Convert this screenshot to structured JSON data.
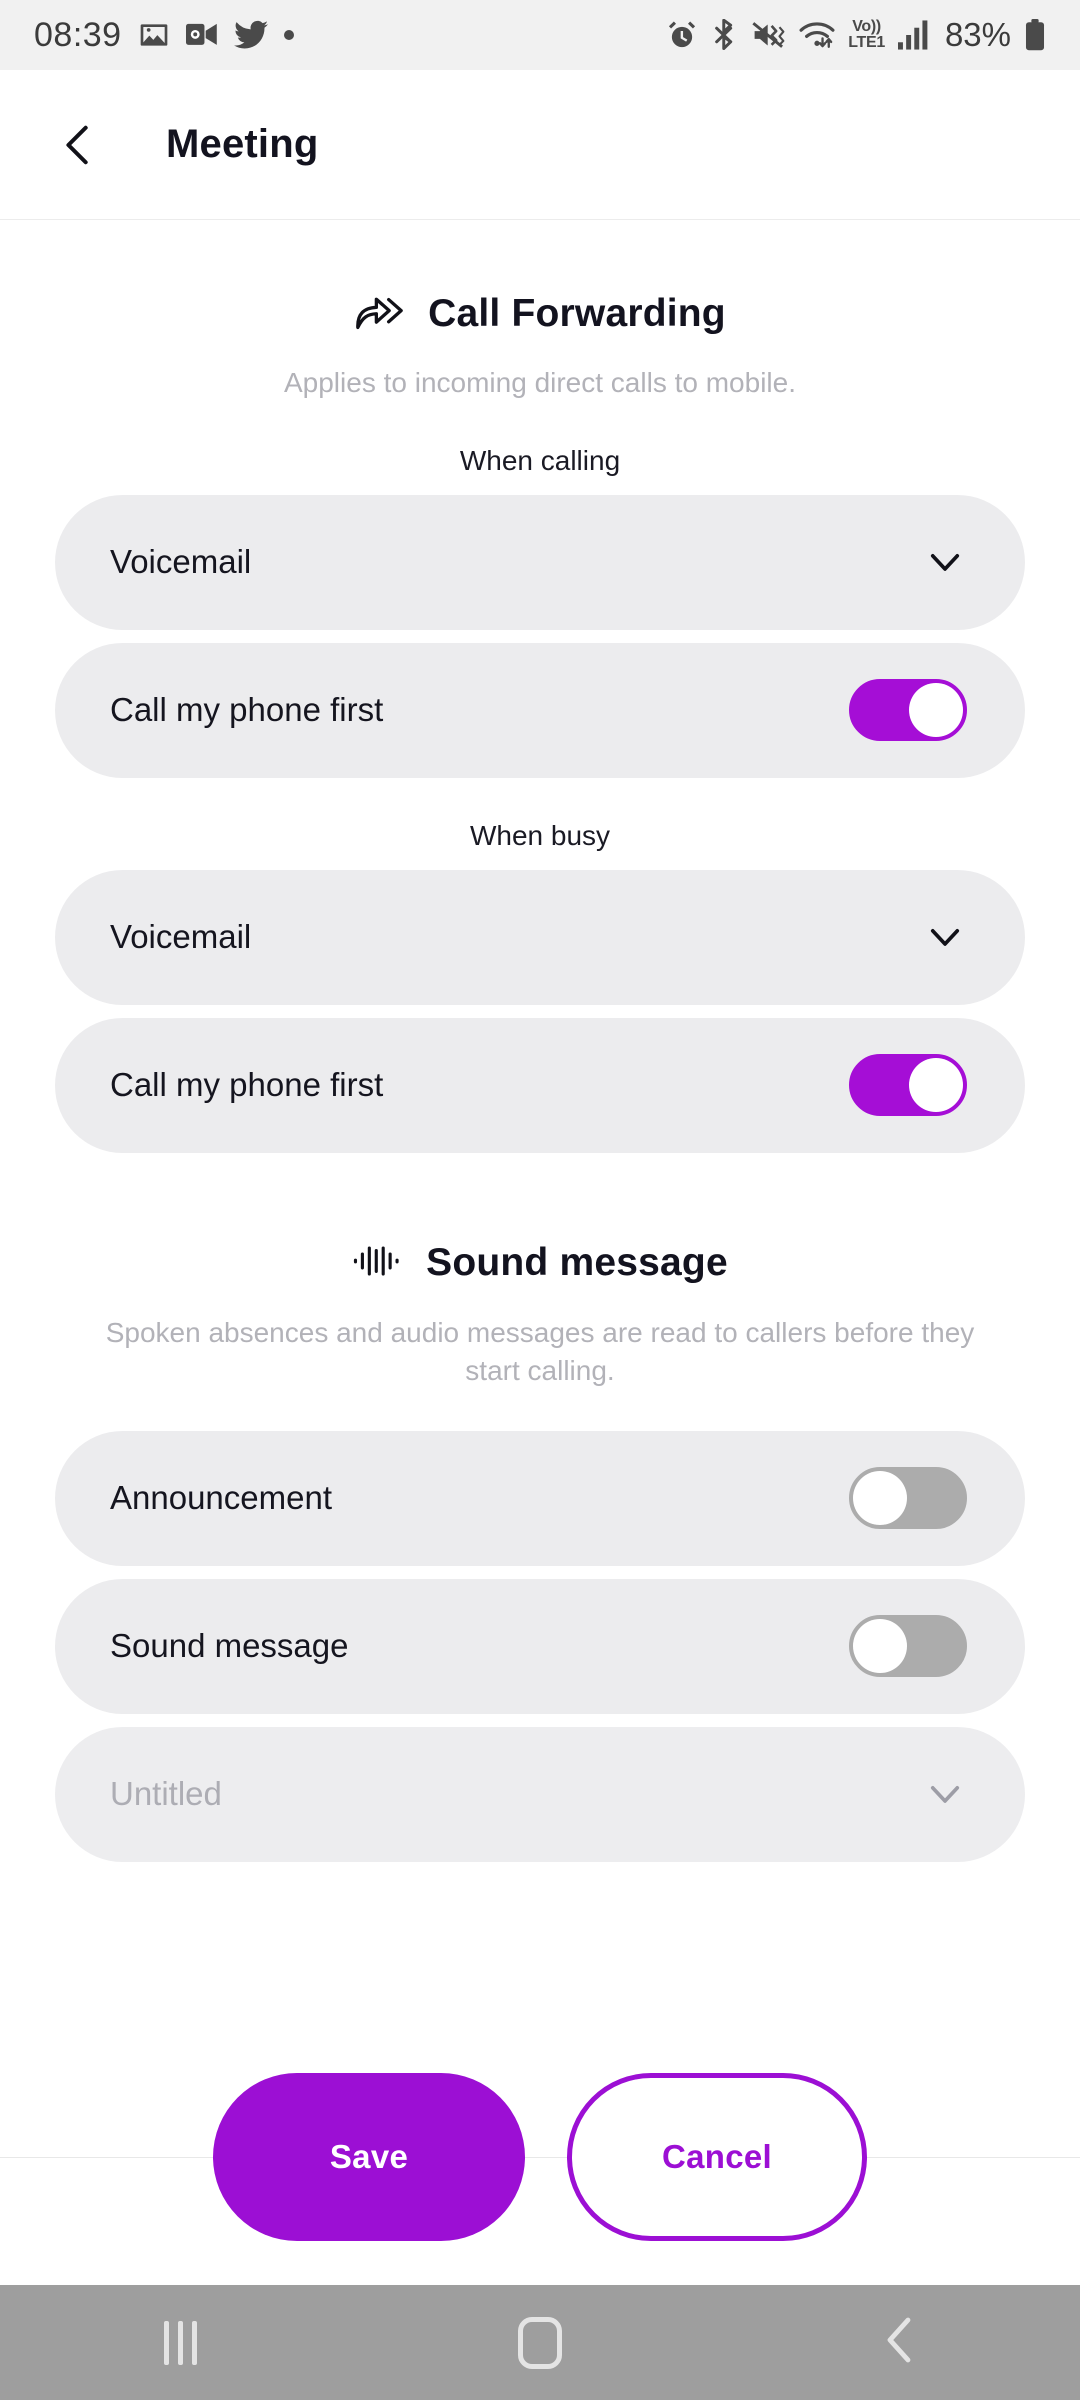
{
  "status_bar": {
    "time": "08:39",
    "left_icons": [
      "photos-icon",
      "outlook-calendar-icon",
      "twitter-icon",
      "more-notifications-dot"
    ],
    "right_icons": [
      "alarm-icon",
      "bluetooth-icon",
      "mute-vibrate-icon",
      "wifi-icon",
      "volte-icon",
      "signal-bars-icon",
      "battery-icon"
    ],
    "network_label_top": "Vo))",
    "network_label_bottom": "LTE1",
    "battery_percent": "83%"
  },
  "app_bar": {
    "back_label": "back-chevron",
    "title": "Meeting"
  },
  "call_forwarding": {
    "icon": "forward-arrow-icon",
    "title": "Call Forwarding",
    "description": "Applies to incoming direct calls to mobile.",
    "groups": [
      {
        "label": "When calling",
        "select": {
          "value": "Voicemail",
          "chevron": "chevron-down-icon"
        },
        "toggle": {
          "label": "Call my phone first",
          "state": "on"
        }
      },
      {
        "label": "When busy",
        "select": {
          "value": "Voicemail",
          "chevron": "chevron-down-icon"
        },
        "toggle": {
          "label": "Call my phone first",
          "state": "on"
        }
      }
    ]
  },
  "sound_message": {
    "icon": "waveform-icon",
    "title": "Sound message",
    "description": "Spoken absences and audio messages are read to callers before they start calling.",
    "rows": [
      {
        "label": "Announcement",
        "state": "off"
      },
      {
        "label": "Sound message",
        "state": "off"
      }
    ],
    "select": {
      "value": "Untitled",
      "chevron": "chevron-down-icon",
      "disabled": true
    }
  },
  "footer": {
    "save_label": "Save",
    "cancel_label": "Cancel"
  },
  "nav_bar": {
    "recents": "recents-icon",
    "home": "home-icon",
    "back": "back-icon"
  },
  "colors": {
    "accent": "#9c0fd4",
    "toggle_on": "#a50ed6",
    "toggle_off": "#acacac",
    "row_bg": "#ececee",
    "muted_text": "#b2b2b8"
  }
}
